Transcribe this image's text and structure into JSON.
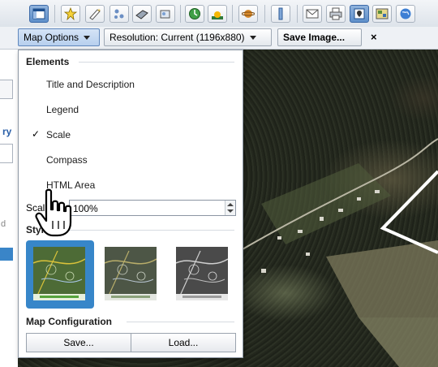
{
  "toolbar2": {
    "map_options_label": "Map Options",
    "resolution_label": "Resolution: Current (1196x880)",
    "save_image_label": "Save Image...",
    "close_label": "×"
  },
  "menu": {
    "elements_title": "Elements",
    "items": [
      {
        "label": "Title and Description",
        "checked": false
      },
      {
        "label": "Legend",
        "checked": false
      },
      {
        "label": "Scale",
        "checked": true
      },
      {
        "label": "Compass",
        "checked": false
      },
      {
        "label": "HTML Area",
        "checked": false
      }
    ],
    "check_mark": "✓",
    "scaling_label": "Scaling:",
    "scaling_value": "100%",
    "styling_title": "Styling",
    "styling_options": [
      {
        "name": "color",
        "selected": true
      },
      {
        "name": "muted",
        "selected": false
      },
      {
        "name": "grayscale",
        "selected": false
      }
    ],
    "config_title": "Map Configuration",
    "save_label": "Save...",
    "load_label": "Load..."
  },
  "left_panel": {
    "edge_text": "ry",
    "edge_d": "d"
  },
  "colors": {
    "accent": "#3786c9",
    "menu_button_active": "#b7cfee"
  },
  "icons": [
    "layout-icon",
    "new-point-icon",
    "new-line-icon",
    "new-multipoint-icon",
    "new-polygon-icon",
    "new-image-overlay-icon",
    "historical-imagery-icon",
    "sunlight-icon",
    "planets-icon",
    "ruler-icon",
    "email-icon",
    "print-icon",
    "save-image-icon",
    "map-view-icon",
    "earth-view-icon"
  ]
}
